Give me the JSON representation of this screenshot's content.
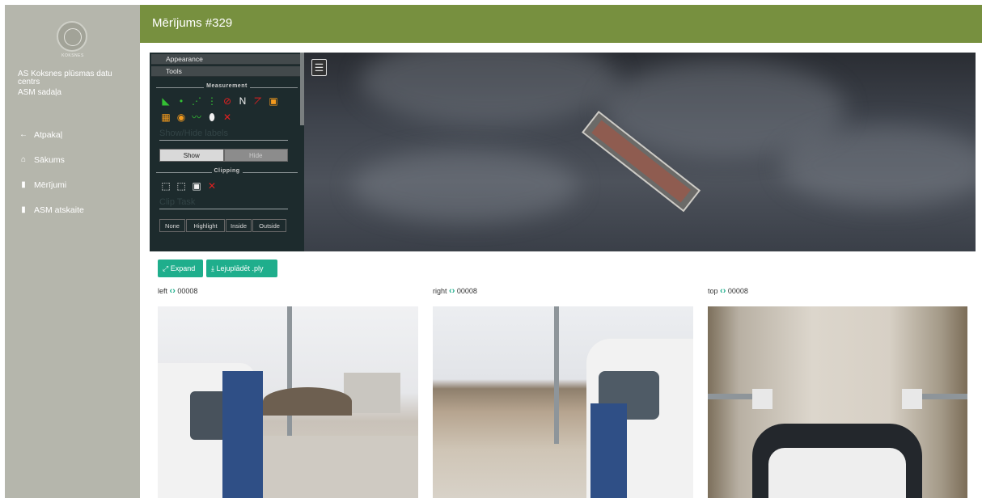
{
  "sidebar": {
    "logo_text": "KOKSNES",
    "company": "AS Koksnes plūsmas datu centrs",
    "section": "ASM sadaļa",
    "nav": [
      {
        "icon": "←",
        "label": "Atpakaļ"
      },
      {
        "icon": "⌂",
        "label": "Sākums"
      },
      {
        "icon": "▮",
        "label": "Mērījumi"
      },
      {
        "icon": "▮",
        "label": "ASM atskaite"
      }
    ]
  },
  "header": {
    "title": "Mērījums #329"
  },
  "viewer": {
    "panel": {
      "accordion": [
        "Appearance",
        "Tools"
      ],
      "measurement_title": "Measurement",
      "labels_heading": "Show/Hide labels",
      "labels_options": [
        "Show",
        "Hide"
      ],
      "labels_selected": "Show",
      "clipping_title": "Clipping",
      "clip_heading": "Clip Task",
      "clip_options": [
        "None",
        "Highlight",
        "Inside",
        "Outside"
      ],
      "clip_selected": "Highlight",
      "compass_label": "N"
    },
    "menu_icon": "hamburger-menu-icon"
  },
  "actions": {
    "expand_label": "Expand",
    "download_label": "Lejuplādēt .ply"
  },
  "cameras": [
    {
      "name": "left",
      "frame": "00008"
    },
    {
      "name": "right",
      "frame": "00008"
    },
    {
      "name": "top",
      "frame": "00008"
    }
  ],
  "colors": {
    "sidebar": "#b5b6ac",
    "header": "#77903f",
    "accent": "#1fae8c",
    "panel": "#1d2b2d"
  }
}
